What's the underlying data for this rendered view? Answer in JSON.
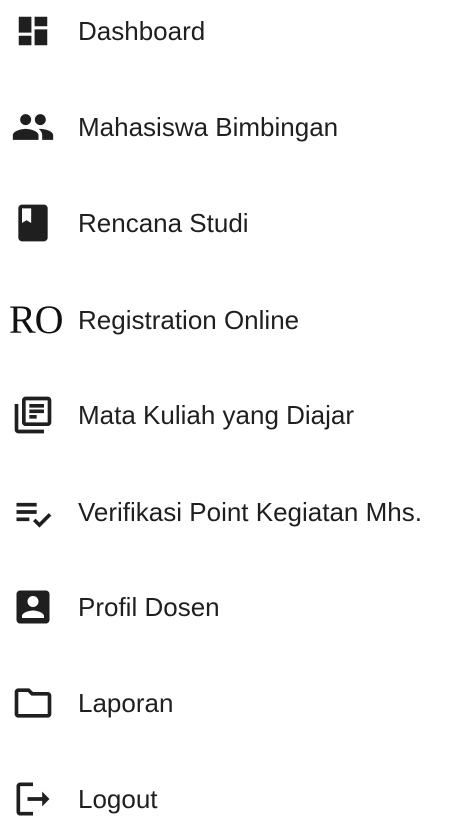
{
  "menu": {
    "items": [
      {
        "label": "Dashboard",
        "icon": "dashboard-icon"
      },
      {
        "label": "Mahasiswa Bimbingan",
        "icon": "people-icon"
      },
      {
        "label": "Rencana Studi",
        "icon": "book-icon"
      },
      {
        "label": "Registration Online",
        "icon": "ro-text-icon",
        "icon_text": "RO"
      },
      {
        "label": "Mata Kuliah yang Diajar",
        "icon": "library-books-icon"
      },
      {
        "label": "Verifikasi Point Kegiatan Mhs.",
        "icon": "checklist-icon"
      },
      {
        "label": "Profil Dosen",
        "icon": "account-box-icon"
      },
      {
        "label": "Laporan",
        "icon": "folder-icon"
      },
      {
        "label": "Logout",
        "icon": "logout-icon"
      }
    ]
  },
  "colors": {
    "icon": "#1f1f1f",
    "text": "#1f1f1f",
    "background": "#ffffff"
  }
}
